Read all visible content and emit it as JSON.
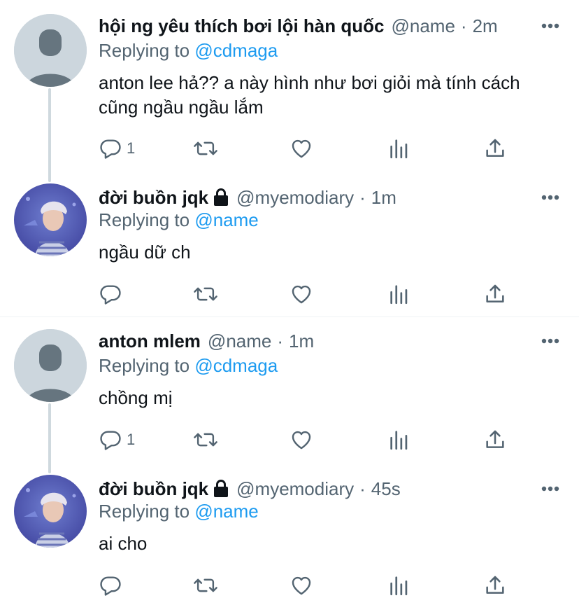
{
  "tweets": [
    {
      "name": "hội ng yêu thích bơi lội hàn quốc",
      "handle": "@name",
      "separator": "·",
      "time": "2m",
      "replying_prefix": "Replying to",
      "replying_to": "@cdmaga",
      "text": "anton lee hả?? a này hình như bơi giỏi mà tính cách cũng ngầu ngầu lắm",
      "reply_count": "1",
      "avatar": "default-avatar",
      "locked": false
    },
    {
      "name": "đời buồn jqk",
      "handle": "@myemodiary",
      "separator": "·",
      "time": "1m",
      "replying_prefix": "Replying to",
      "replying_to": "@name",
      "text": "ngầu dữ ch",
      "reply_count": "",
      "avatar": "photo-avatar",
      "locked": true
    },
    {
      "name": "anton mlem",
      "handle": "@name",
      "separator": "·",
      "time": "1m",
      "replying_prefix": "Replying to",
      "replying_to": "@cdmaga",
      "text": "chồng mị",
      "reply_count": "1",
      "avatar": "default-avatar",
      "locked": false
    },
    {
      "name": "đời buồn jqk",
      "handle": "@myemodiary",
      "separator": "·",
      "time": "45s",
      "replying_prefix": "Replying to",
      "replying_to": "@name",
      "text": "ai cho",
      "reply_count": "",
      "avatar": "photo-avatar",
      "locked": true
    }
  ],
  "icons": {
    "more": "more-dots-icon",
    "lock": "lock-icon",
    "reply": "reply-icon",
    "retweet": "retweet-icon",
    "like": "like-icon",
    "analytics": "analytics-icon",
    "share": "share-icon"
  },
  "colors": {
    "text": "#0f1419",
    "secondary": "#536471",
    "accent": "#1d9bf0",
    "thread_line": "#cfd9de",
    "avatar_bg": "#ccd6dd",
    "avatar_fg": "#66757f"
  }
}
